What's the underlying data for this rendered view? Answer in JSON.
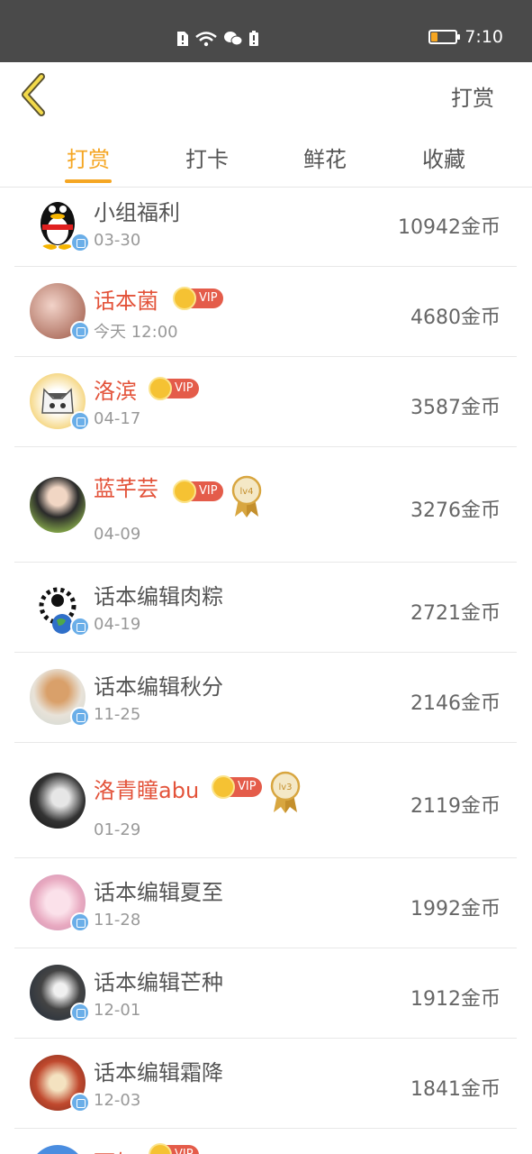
{
  "status_bar": {
    "time": "7:10"
  },
  "nav": {
    "action_label": "打赏"
  },
  "tabs": [
    {
      "label": "打赏",
      "active": true
    },
    {
      "label": "打卡",
      "active": false
    },
    {
      "label": "鲜花",
      "active": false
    },
    {
      "label": "收藏",
      "active": false
    }
  ],
  "vip_label": "VIP",
  "rows": [
    {
      "name": "小组福利",
      "date": "03-30",
      "amount": "10942金币",
      "vip": false,
      "official": true
    },
    {
      "name": "话本菌",
      "date": "今天 12:00",
      "amount": "4680金币",
      "vip": true,
      "official": true
    },
    {
      "name": "洛滨",
      "date": "04-17",
      "amount": "3587金币",
      "vip": true,
      "official": true
    },
    {
      "name": "蓝芊芸",
      "date": "04-09",
      "amount": "3276金币",
      "vip": true,
      "official": false,
      "medal": "lv4"
    },
    {
      "name": "话本编辑肉粽",
      "date": "04-19",
      "amount": "2721金币",
      "vip": false,
      "official": true
    },
    {
      "name": "话本编辑秋分",
      "date": "11-25",
      "amount": "2146金币",
      "vip": false,
      "official": true
    },
    {
      "name": "洛青瞳abu",
      "date": "01-29",
      "amount": "2119金币",
      "vip": true,
      "official": false,
      "medal": "lv3"
    },
    {
      "name": "话本编辑夏至",
      "date": "11-28",
      "amount": "1992金币",
      "vip": false,
      "official": true
    },
    {
      "name": "话本编辑芒种",
      "date": "12-01",
      "amount": "1912金币",
      "vip": false,
      "official": true
    },
    {
      "name": "话本编辑霜降",
      "date": "12-03",
      "amount": "1841金币",
      "vip": false,
      "official": true
    },
    {
      "name": "雨如",
      "date": "",
      "amount": "",
      "vip": true,
      "official": false
    }
  ],
  "colors": {
    "accent": "#f5a623",
    "vip_name": "#e3533a",
    "status_bar": "#4a4a4a"
  }
}
